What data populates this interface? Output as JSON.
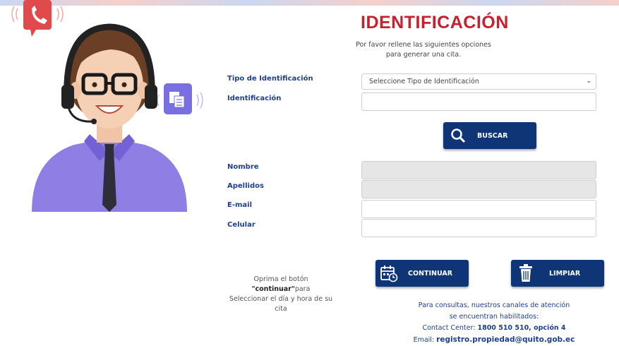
{
  "header": {
    "title": "IDENTIFICACIÓN",
    "subtitle_line1": "Por favor rellene las siguientes opciones",
    "subtitle_line2": "para generar una cita."
  },
  "form": {
    "tipo_label": "Tipo de Identificación",
    "tipo_select_value": "Seleccione Tipo de Identificación",
    "identificacion_label": "Identificación",
    "identificacion_value": "",
    "nombre_label": "Nombre",
    "apellidos_label": "Apellidos",
    "email_label": "E-mail",
    "celular_label": "Celular"
  },
  "buttons": {
    "buscar": "BUSCAR",
    "continuar": "CONTINUAR",
    "limpiar": "LIMPIAR"
  },
  "hint": {
    "prefix": "Oprima el botón ",
    "keyword": "\"continuar\"",
    "suffix": "para",
    "line2": "Seleccionar el día y hora de su cita"
  },
  "contact": {
    "line1": "Para consultas, nuestros canales de atención",
    "line2": "se encuentran habilitados:",
    "center_prefix": "Contact Center: ",
    "center_value": "1800 510 510, opción 4",
    "email_prefix": "Email: ",
    "email_value": "registro.propiedad@quito.gob.ec"
  },
  "colors": {
    "title_red": "#c8202e",
    "label_blue": "#1e3f8c",
    "button_navy": "#0f3576"
  },
  "icons": [
    "phone-icon",
    "chat-document-icon",
    "search-icon",
    "calendar-icon",
    "trash-icon",
    "chevron-down-icon"
  ]
}
